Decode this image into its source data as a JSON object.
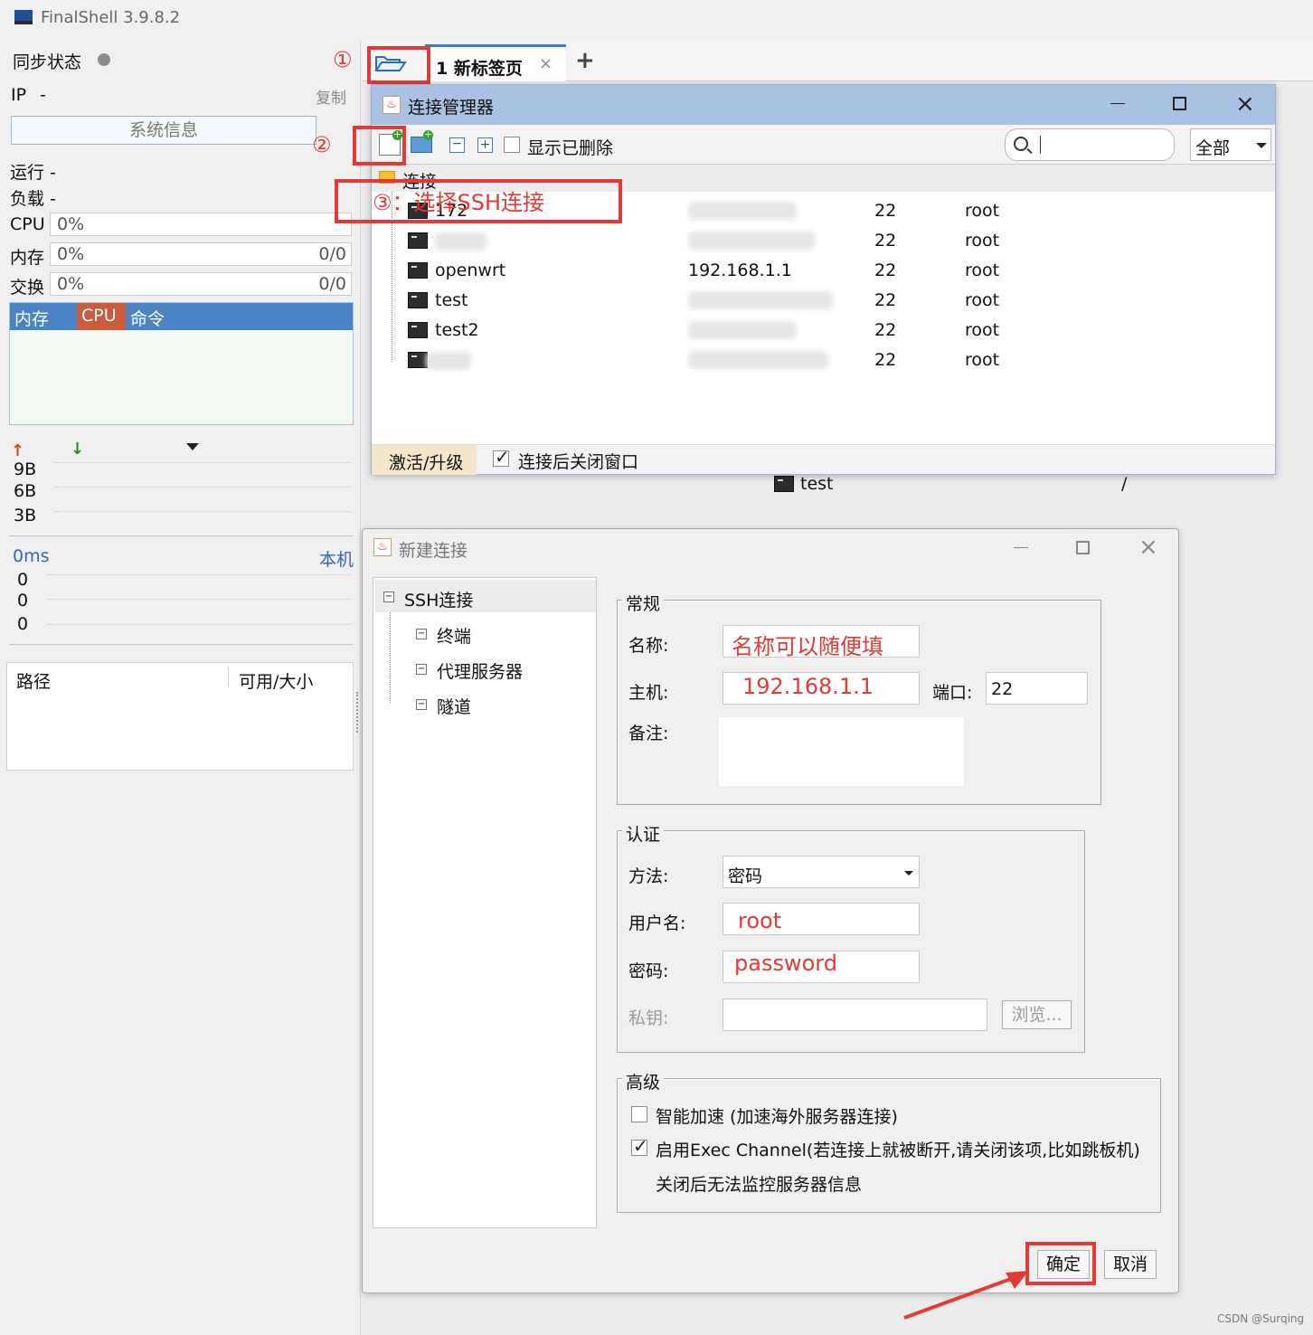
{
  "app": {
    "title": "FinalShell 3.9.8.2"
  },
  "sidebar": {
    "sync_label": "同步状态",
    "ip_label": "IP",
    "ip_value": "-",
    "copy_label": "复制",
    "sysinfo_button": "系统信息",
    "run_label": "运行 -",
    "load_label": "负载 -",
    "cpu_label": "CPU",
    "cpu_value": "0%",
    "mem_label": "内存",
    "mem_value": "0%",
    "mem_ratio": "0/0",
    "swap_label": "交换",
    "swap_value": "0%",
    "swap_ratio": "0/0",
    "proc_tabs": [
      "内存",
      "CPU",
      "命令"
    ],
    "net_ticks": [
      "9B",
      "6B",
      "3B"
    ],
    "latency_label": "0ms",
    "latency_target": "本机",
    "latency_values": [
      "0",
      "0",
      "0"
    ],
    "disk_path_header": "路径",
    "disk_size_header": "可用/大小"
  },
  "tabs": {
    "active_tab": "1 新标签页",
    "add_tab": "+"
  },
  "background_row": {
    "name": "test",
    "path": "/"
  },
  "conn_manager": {
    "title": "连接管理器",
    "show_deleted": "显示已删除",
    "search_placeholder": "",
    "filter_value": "全部",
    "folder_label": "连接",
    "rows": [
      {
        "name": "172",
        "host": "",
        "port": "22",
        "user": "root"
      },
      {
        "name": "aliyun",
        "host": "",
        "port": "22",
        "user": "root"
      },
      {
        "name": "openwrt",
        "host": "192.168.1.1",
        "port": "22",
        "user": "root"
      },
      {
        "name": "test",
        "host": "",
        "port": "22",
        "user": "root"
      },
      {
        "name": "test2",
        "host": "",
        "port": "22",
        "user": "root"
      },
      {
        "name": "",
        "host": "",
        "port": "22",
        "user": "root"
      }
    ],
    "activate_label": "激活/升级",
    "close_after_label": "连接后关闭窗口"
  },
  "annotations": {
    "step1": "①",
    "step2": "②",
    "step3": "③：选择SSH连接"
  },
  "new_conn": {
    "title": "新建连接",
    "tree": {
      "root": "SSH连接",
      "children": [
        "终端",
        "代理服务器",
        "隧道"
      ]
    },
    "general_label": "常规",
    "name_label": "名称:",
    "name_value": "名称可以随便填",
    "host_label": "主机:",
    "host_value": "192.168.1.1",
    "port_label": "端口:",
    "port_value": "22",
    "note_label": "备注:",
    "auth_label": "认证",
    "method_label": "方法:",
    "method_value": "密码",
    "user_label": "用户名:",
    "user_value": "root",
    "pass_label": "密码:",
    "pass_value": "password",
    "key_label": "私钥:",
    "browse_label": "浏览...",
    "advanced_label": "高级",
    "smart_accel": "智能加速 (加速海外服务器连接)",
    "exec_channel": "启用Exec Channel(若连接上就被断开,请关闭该项,比如跳板机)",
    "exec_note": "关闭后无法监控服务器信息",
    "ok_label": "确定",
    "cancel_label": "取消"
  },
  "watermark": "CSDN @Surqing"
}
